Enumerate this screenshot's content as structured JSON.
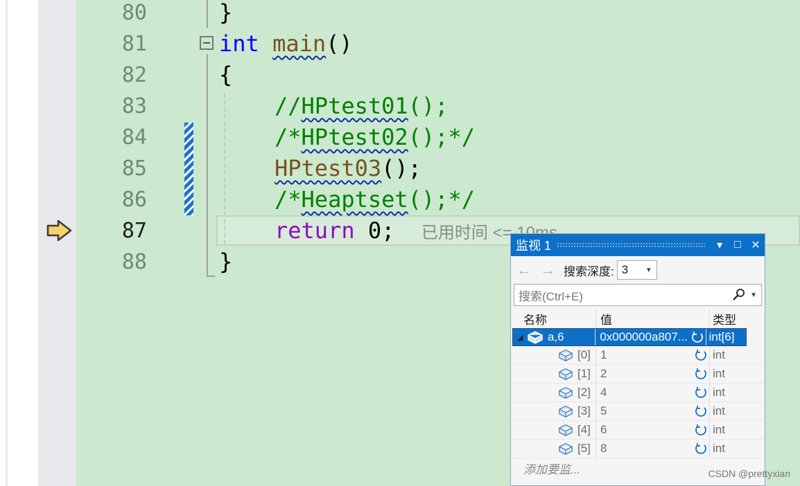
{
  "editor": {
    "lines": [
      {
        "num": "80",
        "text": "}"
      },
      {
        "num": "81",
        "kw": "int",
        "fn": "main",
        "rest": "()"
      },
      {
        "num": "82",
        "text": "{"
      },
      {
        "num": "83",
        "cm_pre": "//",
        "cm_sq": "HPtest01",
        "cm_post": "();"
      },
      {
        "num": "84",
        "cm_pre": "/*",
        "cm_sq": "HPtest02",
        "cm_post": "();*/"
      },
      {
        "num": "85",
        "fn_sq": "HPtest03",
        "rest": "();"
      },
      {
        "num": "86",
        "cm_pre": "/*",
        "cm_sq": "Heaptset",
        "cm_post": "();*/"
      },
      {
        "num": "87",
        "kw": "return",
        "rest": " 0;",
        "hint": "已用时间 <= 10ms"
      },
      {
        "num": "88",
        "text": "}"
      }
    ]
  },
  "watch": {
    "title": "监视 1",
    "depth_label": "搜索深度:",
    "depth_value": "3",
    "search_placeholder": "搜索(Ctrl+E)",
    "headers": {
      "name": "名称",
      "value": "值",
      "type": "类型"
    },
    "root": {
      "name": "a,6",
      "value": "0x000000a807...",
      "type": "int[6]"
    },
    "children": [
      {
        "name": "[0]",
        "value": "1",
        "type": "int"
      },
      {
        "name": "[1]",
        "value": "2",
        "type": "int"
      },
      {
        "name": "[2]",
        "value": "4",
        "type": "int"
      },
      {
        "name": "[3]",
        "value": "5",
        "type": "int"
      },
      {
        "name": "[4]",
        "value": "6",
        "type": "int"
      },
      {
        "name": "[5]",
        "value": "8",
        "type": "int"
      }
    ],
    "add_item": "添加要监..."
  },
  "watermark": "CSDN @prettyxian"
}
